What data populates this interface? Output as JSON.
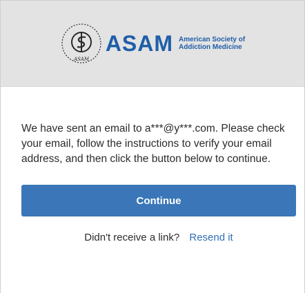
{
  "header": {
    "logo": {
      "seal_text": "SOCIETY OF ADDICTION MEDICINE",
      "seal_bottom": "ASAM",
      "wordmark": "ASAM",
      "tagline_line1": "American Society of",
      "tagline_line2": "Addiction Medicine",
      "brand_color": "#1f5ea8"
    }
  },
  "main": {
    "message": "We have sent an email to a***@y***.com. Please check your email, follow the instructions to verify your email address, and then click the button below to continue.",
    "continue_label": "Continue",
    "resend_prompt": "Didn't receive a link?",
    "resend_link": "Resend it",
    "button_color": "#3a76b8",
    "link_color": "#2f6fb5"
  }
}
